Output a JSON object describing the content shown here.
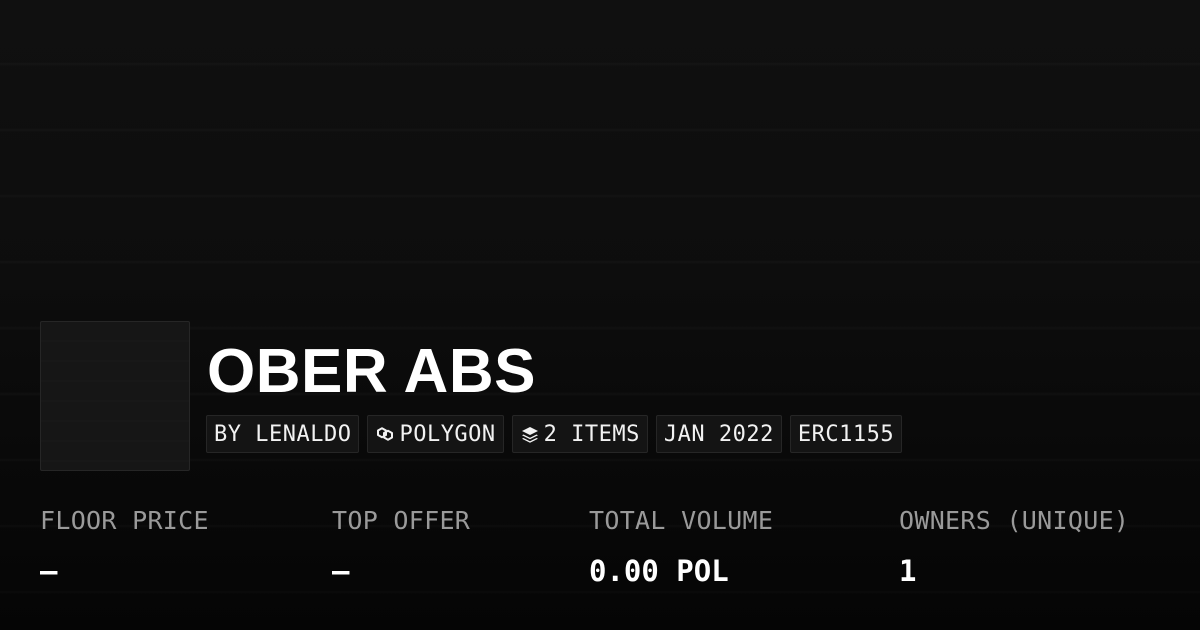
{
  "collection": {
    "title": "OBER ABS",
    "tags": [
      {
        "label": "BY LENALDO",
        "icon": ""
      },
      {
        "label": "POLYGON",
        "icon": "polygon-chain-icon"
      },
      {
        "label": "2 ITEMS",
        "icon": "layers-icon"
      },
      {
        "label": "JAN 2022",
        "icon": ""
      },
      {
        "label": "ERC1155",
        "icon": ""
      }
    ]
  },
  "stats": [
    {
      "label": "FLOOR PRICE",
      "value": "–"
    },
    {
      "label": "TOP OFFER",
      "value": "–"
    },
    {
      "label": "TOTAL VOLUME",
      "value": "0.00 POL"
    },
    {
      "label": "OWNERS (UNIQUE)",
      "value": "1"
    }
  ],
  "colors": {
    "background": "#0c0c0c",
    "text_primary": "#ffffff",
    "text_muted": "#9a9a9a",
    "tag_background": "#141414",
    "tag_border": "#262626"
  }
}
